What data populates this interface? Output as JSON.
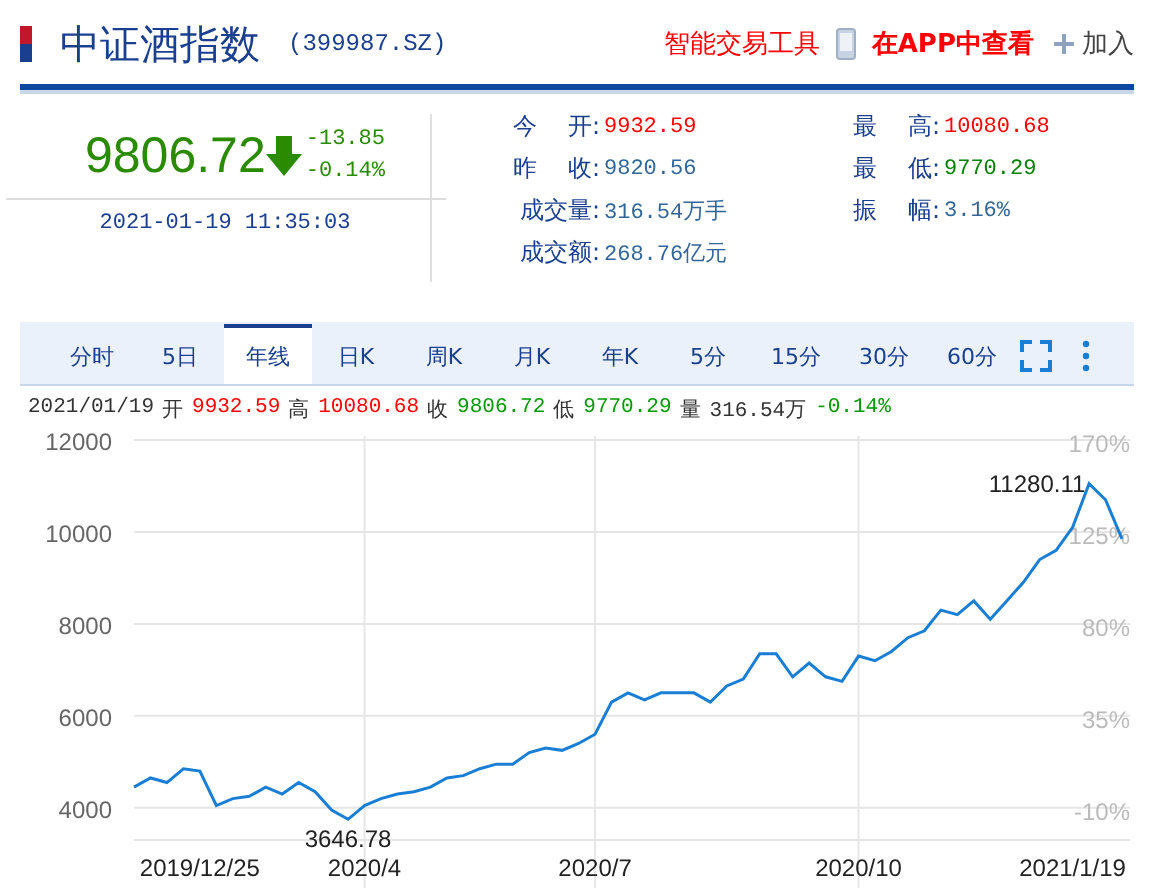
{
  "header": {
    "title": "中证酒指数",
    "code": "(399987.SZ)",
    "links": [
      {
        "label": "智能交易工具",
        "kind": "plain"
      },
      {
        "label": "在APP中查看",
        "kind": "app"
      },
      {
        "label": "加入",
        "kind": "add"
      }
    ]
  },
  "quote": {
    "price": "9806.72",
    "down": true,
    "change": "-13.85",
    "change_pct": "-0.14%",
    "datetime": "2021-01-19 11:35:03"
  },
  "stats": [
    {
      "label": "今    开:",
      "value": "9932.59",
      "color": "#ff0000"
    },
    {
      "label": "最    高:",
      "value": "10080.68",
      "color": "#ff0000"
    },
    {
      "label": "昨    收:",
      "value": "9820.56",
      "color": "#336699"
    },
    {
      "label": "最    低:",
      "value": "9770.29",
      "color": "#008000"
    },
    {
      "label": "成交量:",
      "value": "316.54万手",
      "color": "#336699"
    },
    {
      "label": "振    幅:",
      "value": "3.16%",
      "color": "#336699"
    },
    {
      "label": "成交额:",
      "value": "268.76亿元",
      "color": "#336699"
    }
  ],
  "tabs": [
    {
      "label": "分时",
      "selected": false
    },
    {
      "label": "5日",
      "selected": false
    },
    {
      "label": "年线",
      "selected": true
    },
    {
      "label": "日K",
      "selected": false
    },
    {
      "label": "周K",
      "selected": false
    },
    {
      "label": "月K",
      "selected": false
    },
    {
      "label": "年K",
      "selected": false
    },
    {
      "label": "5分",
      "selected": false
    },
    {
      "label": "15分",
      "selected": false
    },
    {
      "label": "30分",
      "selected": false
    },
    {
      "label": "60分",
      "selected": false
    }
  ],
  "info_line": [
    {
      "label": "2021/01/19"
    },
    {
      "label": "开",
      "value": "9932.59",
      "color": "#ff0000"
    },
    {
      "label": "高",
      "value": "10080.68",
      "color": "#ff0000"
    },
    {
      "label": "收",
      "value": "9806.72",
      "color": "#009900"
    },
    {
      "label": "低",
      "value": "9770.29",
      "color": "#009900"
    },
    {
      "label": "量",
      "value": "316.54万",
      "color": "#333333"
    },
    {
      "value": "-0.14%",
      "color": "#009900"
    }
  ],
  "chart": {
    "right_axis_labels": [
      "170%",
      "125%",
      "80%",
      "35%",
      "-10%"
    ],
    "chart_data": {
      "type": "line",
      "grid": true,
      "categories": [
        null,
        null,
        null,
        null,
        "2019/12/25",
        null,
        null,
        null,
        null,
        null,
        null,
        null,
        null,
        null,
        "2020/4",
        null,
        null,
        null,
        null,
        null,
        null,
        null,
        null,
        null,
        null,
        null,
        null,
        null,
        "2020/7",
        null,
        null,
        null,
        null,
        null,
        null,
        null,
        null,
        null,
        null,
        null,
        null,
        null,
        null,
        null,
        "2020/10",
        null,
        null,
        null,
        null,
        null,
        null,
        null,
        null,
        null,
        null,
        null,
        null,
        "2021/1/19",
        null,
        null,
        null
      ],
      "series": [
        {
          "color": "#1a7fd4",
          "values": [
            4450,
            4650,
            4550,
            4850,
            4800,
            4050,
            4200,
            4250,
            4450,
            4300,
            4550,
            4350,
            3950,
            3750,
            4050,
            4200,
            4300,
            4350,
            4450,
            4650,
            4700,
            4850,
            4950,
            4950,
            5200,
            5300,
            5250,
            5400,
            5600,
            6300,
            6500,
            6350,
            6500,
            6500,
            6500,
            6300,
            6650,
            6800,
            7350,
            7350,
            6850,
            7150,
            6850,
            6750,
            7300,
            7200,
            7400,
            7700,
            7850,
            8300,
            8200,
            8500,
            8100,
            8500,
            8900,
            9400,
            9600,
            10100,
            11050,
            10700,
            9850
          ]
        }
      ],
      "ylim": [
        3300,
        12000
      ],
      "yticks": [
        4000,
        6000,
        8000,
        10000,
        12000
      ],
      "annotations": [
        "11280.11",
        "3646.78"
      ]
    }
  }
}
